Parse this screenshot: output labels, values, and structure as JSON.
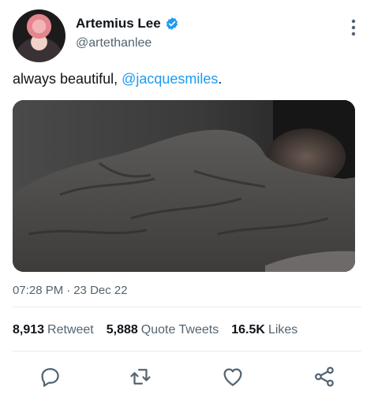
{
  "author": {
    "display_name": "Artemius Lee",
    "handle": "@artethanlee",
    "verified": true
  },
  "tweet": {
    "text": "always beautiful, ",
    "mention": "@jacquesmiles",
    "text_end": ".",
    "timestamp_time": "07:28 PM",
    "timestamp_sep": "·",
    "timestamp_date": "23 Dec 22"
  },
  "stats": {
    "retweets": "8,913",
    "retweets_label": "Retweet",
    "quotes": "5,888",
    "quotes_label": "Quote Tweets",
    "likes": "16.5K",
    "likes_label": "Likes"
  },
  "colors": {
    "accent": "#1d9bf0",
    "secondary_text": "#536471",
    "action_icon": "#536471"
  },
  "icons": {
    "reply": "reply-icon",
    "retweet": "retweet-icon",
    "like": "heart-icon",
    "share": "share-icon",
    "more": "more-icon",
    "verified": "verified-badge-icon"
  }
}
